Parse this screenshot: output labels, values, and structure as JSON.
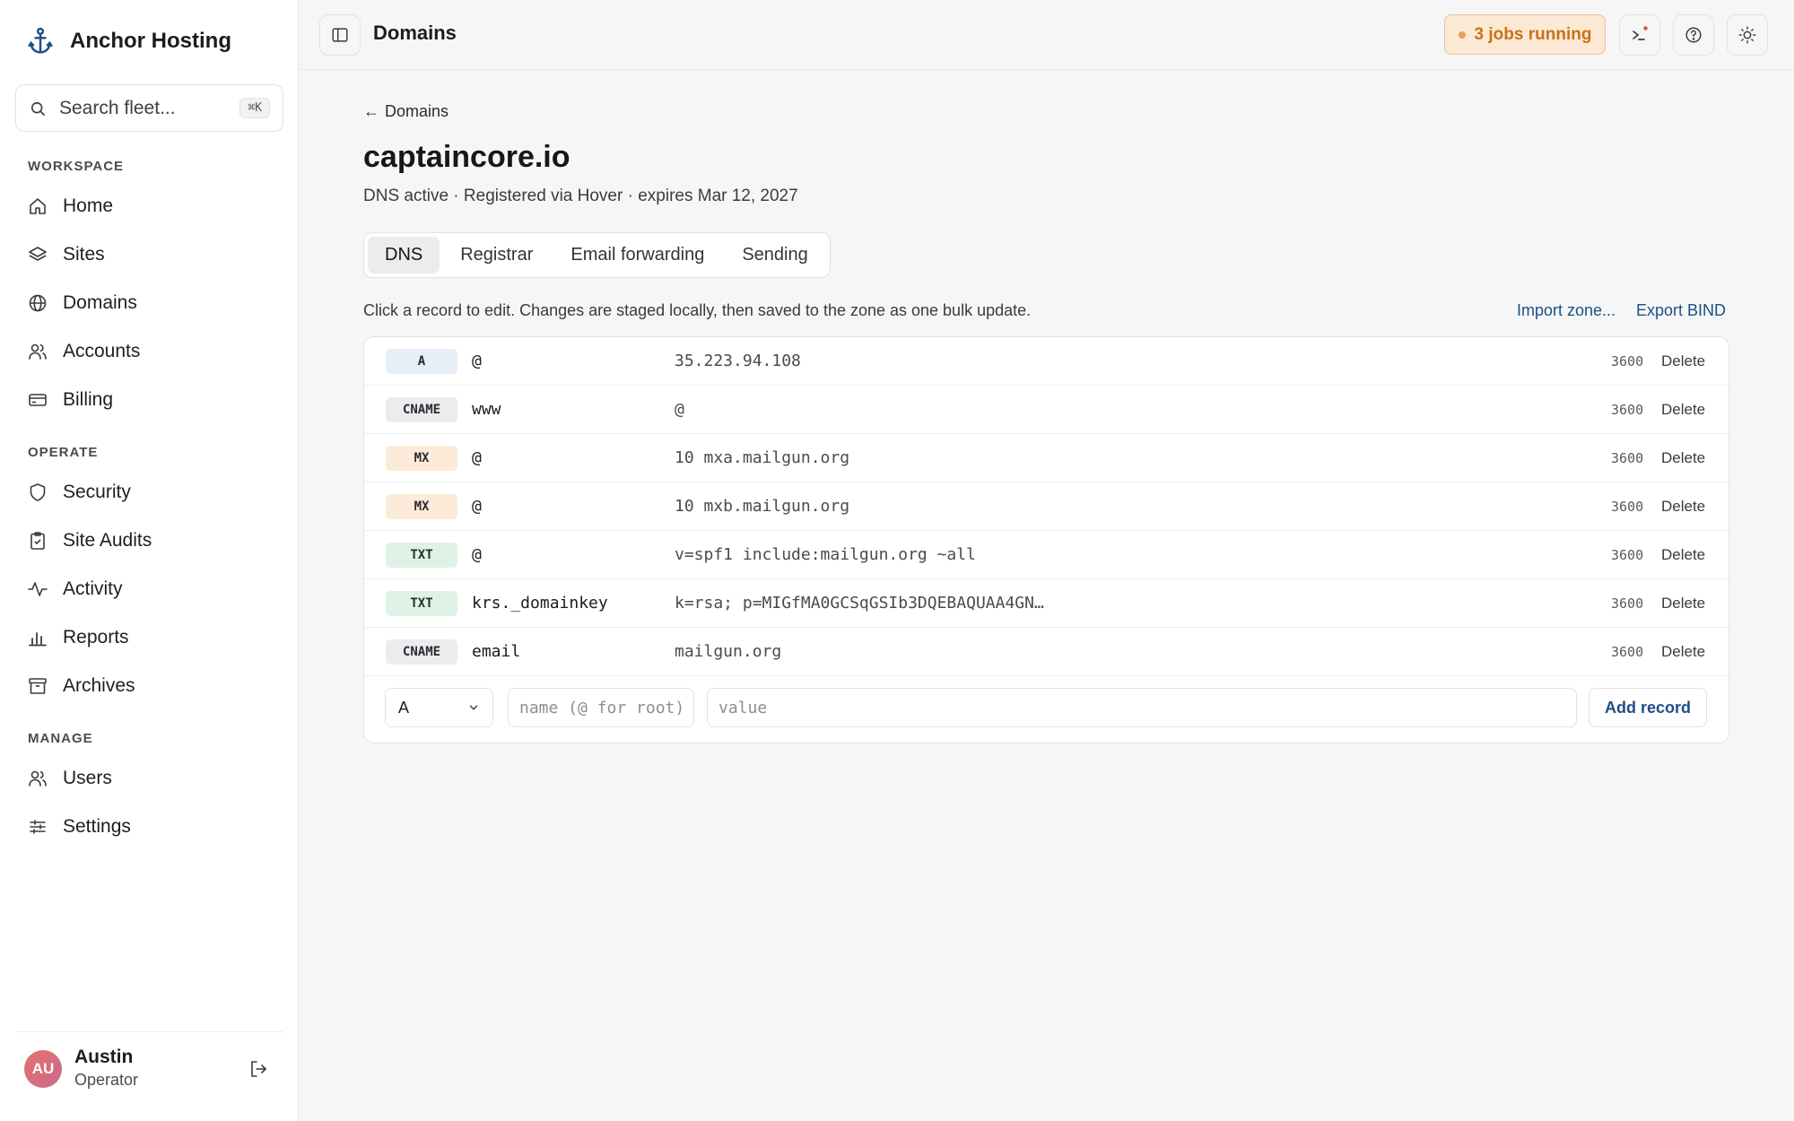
{
  "brand": {
    "name": "Anchor Hosting"
  },
  "search": {
    "placeholder": "Search fleet...",
    "shortcut": "⌘K"
  },
  "sidebar": {
    "sections": [
      {
        "label": "WORKSPACE",
        "items": [
          "Home",
          "Sites",
          "Domains",
          "Accounts",
          "Billing"
        ]
      },
      {
        "label": "OPERATE",
        "items": [
          "Security",
          "Site Audits",
          "Activity",
          "Reports",
          "Archives"
        ]
      },
      {
        "label": "MANAGE",
        "items": [
          "Users",
          "Settings"
        ]
      }
    ]
  },
  "user": {
    "initials": "AU",
    "name": "Austin",
    "role": "Operator"
  },
  "topbar": {
    "title": "Domains",
    "jobs_label": "3 jobs running"
  },
  "page": {
    "back_label": "Domains",
    "title": "captaincore.io",
    "subtitle": "DNS active · Registered via Hover · expires Mar 12, 2027",
    "tabs": [
      "DNS",
      "Registrar",
      "Email forwarding",
      "Sending"
    ],
    "active_tab": "DNS",
    "help_text": "Click a record to edit. Changes are staged locally, then saved to the zone as one bulk update.",
    "import_label": "Import zone...",
    "export_label": "Export BIND"
  },
  "records": [
    {
      "type": "A",
      "name": "@",
      "value": "35.223.94.108",
      "ttl": "3600",
      "action": "Delete"
    },
    {
      "type": "CNAME",
      "name": "www",
      "value": "@",
      "ttl": "3600",
      "action": "Delete"
    },
    {
      "type": "MX",
      "name": "@",
      "value": "10 mxa.mailgun.org",
      "ttl": "3600",
      "action": "Delete"
    },
    {
      "type": "MX",
      "name": "@",
      "value": "10 mxb.mailgun.org",
      "ttl": "3600",
      "action": "Delete"
    },
    {
      "type": "TXT",
      "name": "@",
      "value": "v=spf1 include:mailgun.org ~all",
      "ttl": "3600",
      "action": "Delete"
    },
    {
      "type": "TXT",
      "name": "krs._domainkey",
      "value": "k=rsa; p=MIGfMA0GCSqGSIb3DQEBAQUAA4GN…",
      "ttl": "3600",
      "action": "Delete"
    },
    {
      "type": "CNAME",
      "name": "email",
      "value": "mailgun.org",
      "ttl": "3600",
      "action": "Delete"
    }
  ],
  "type_colors": {
    "A": "#e6eef8",
    "CNAME": "#ececef",
    "MX": "#fcebd8",
    "TXT": "#def3e6"
  },
  "add_form": {
    "type_value": "A",
    "name_placeholder": "name (@ for root)",
    "value_placeholder": "value",
    "button_label": "Add record"
  }
}
